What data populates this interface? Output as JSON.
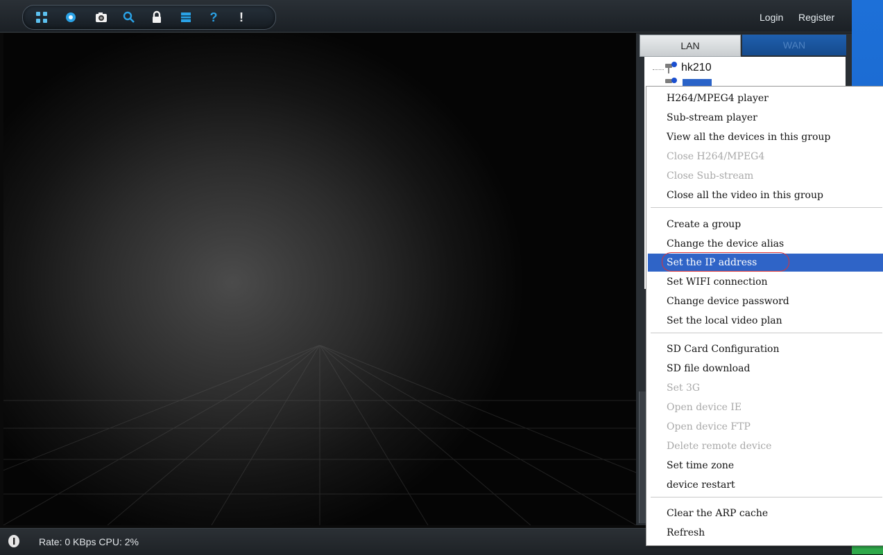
{
  "header": {
    "login": "Login",
    "register": "Register"
  },
  "toolbar": {
    "icons": [
      "fullscreen-icon",
      "record-icon",
      "camera-icon",
      "search-icon",
      "lock-icon",
      "layout-icon",
      "help-icon",
      "info-icon"
    ]
  },
  "tabs": {
    "lan": "LAN",
    "wan": "WAN"
  },
  "devices": [
    {
      "name": "hk210"
    }
  ],
  "status": {
    "text": "Rate: 0 KBps CPU:  2%"
  },
  "menu": {
    "items": [
      {
        "label": "H264/MPEG4 player",
        "enabled": true
      },
      {
        "label": "Sub-stream player",
        "enabled": true
      },
      {
        "label": "View all the devices in this group",
        "enabled": true
      },
      {
        "label": "Close H264/MPEG4",
        "enabled": false
      },
      {
        "label": "Close Sub-stream",
        "enabled": false
      },
      {
        "label": "Close all the video in this group",
        "enabled": true
      },
      {
        "label": "Create a group",
        "enabled": true
      },
      {
        "label": "Change the device alias",
        "enabled": true
      },
      {
        "label": "Set the IP address",
        "enabled": true,
        "highlighted": true
      },
      {
        "label": "Set WIFI connection",
        "enabled": true
      },
      {
        "label": "Change device password",
        "enabled": true
      },
      {
        "label": "Set the local video plan",
        "enabled": true
      },
      {
        "label": "SD Card Configuration",
        "enabled": true
      },
      {
        "label": "SD file download",
        "enabled": true
      },
      {
        "label": "Set 3G",
        "enabled": false
      },
      {
        "label": "Open device IE",
        "enabled": false
      },
      {
        "label": "Open device FTP",
        "enabled": false
      },
      {
        "label": "Delete remote device",
        "enabled": false
      },
      {
        "label": "Set time zone",
        "enabled": true
      },
      {
        "label": "device restart",
        "enabled": true
      },
      {
        "label": "Clear the ARP cache",
        "enabled": true
      },
      {
        "label": "Refresh",
        "enabled": true
      }
    ]
  },
  "colors": {
    "highlight": "#2f64c7",
    "annotation": "#dd3333",
    "desktop": "#1d70d8"
  }
}
